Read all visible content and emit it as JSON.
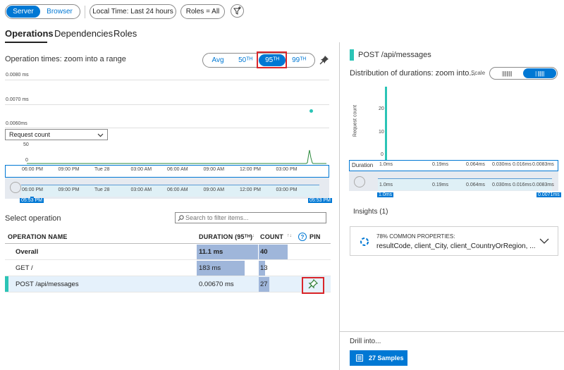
{
  "toolbar": {
    "server_label": "Server",
    "browser_label": "Browser",
    "time_label": "Local Time: Last 24 hours",
    "roles_label": "Roles = All",
    "filter_icon": "filter-add-icon"
  },
  "tabs": [
    {
      "label": "Operations"
    },
    {
      "label": "Dependencies"
    },
    {
      "label": "Roles"
    }
  ],
  "op_chart": {
    "title": "Operation times: zoom into a range",
    "percentiles": {
      "avg": "Avg",
      "p50": "50ᵀᴴ",
      "p95": "95ᵀᴴ",
      "p99": "99ᵀᴴ"
    },
    "y_ticks": [
      "0.0080 ms",
      "0.0070 ms",
      "0.0060ms"
    ],
    "dropdown_value": "Request count",
    "count_ticks": [
      "50",
      "0"
    ],
    "x_ticks": [
      "06:00 PM",
      "09:00 PM",
      "Tue 28",
      "03:00 AM",
      "06:00 AM",
      "09:00 AM",
      "12:00 PM",
      "03:00 PM"
    ],
    "range_start": "05:53 PM",
    "range_end": "05:53 PM"
  },
  "select_operation": {
    "title": "Select operation",
    "search_placeholder": "Search to filter items..."
  },
  "table": {
    "headers": {
      "name": "OPERATION NAME",
      "duration": "DURATION (95ᵀᴴ)",
      "count": "COUNT",
      "pin": "PIN"
    },
    "rows": [
      {
        "name": "Overall",
        "duration": "11.1 ms",
        "count": "40",
        "dur_frac": 1.0,
        "count_frac": 1.0
      },
      {
        "name": "GET /",
        "duration": "183 ms",
        "count": "13",
        "dur_frac": 0.85,
        "count_frac": 0.18
      },
      {
        "name": "POST /api/messages",
        "duration": "0.00670 ms",
        "count": "27",
        "dur_frac": 0.0,
        "count_frac": 0.3
      }
    ]
  },
  "right": {
    "title": "POST /api/messages",
    "dist_title": "Distribution of durations: zoom into...",
    "scale_label": "Scale",
    "y_label": "Request count",
    "y_ticks": [
      "20",
      "10",
      "0"
    ],
    "duration_label": "Duration",
    "x_ticks": [
      "1.0ms",
      "0.19ms",
      "0.064ms",
      "0.030ms",
      "0.016ms",
      "0.0083ms"
    ],
    "range_start": "1.0ms",
    "range_end": "0.0071ms",
    "insights_title": "Insights (1)",
    "insight_pct": "78% COMMON PROPERTIES:",
    "insight_props": "resultCode, client_City, client_CountryOrRegion, ...",
    "drill_title": "Drill into...",
    "samples_label": "27 Samples"
  },
  "colors": {
    "accent": "#0078d4",
    "teal": "#2bc4b6",
    "highlight": "#d9262b",
    "bar": "#9fb6da"
  }
}
